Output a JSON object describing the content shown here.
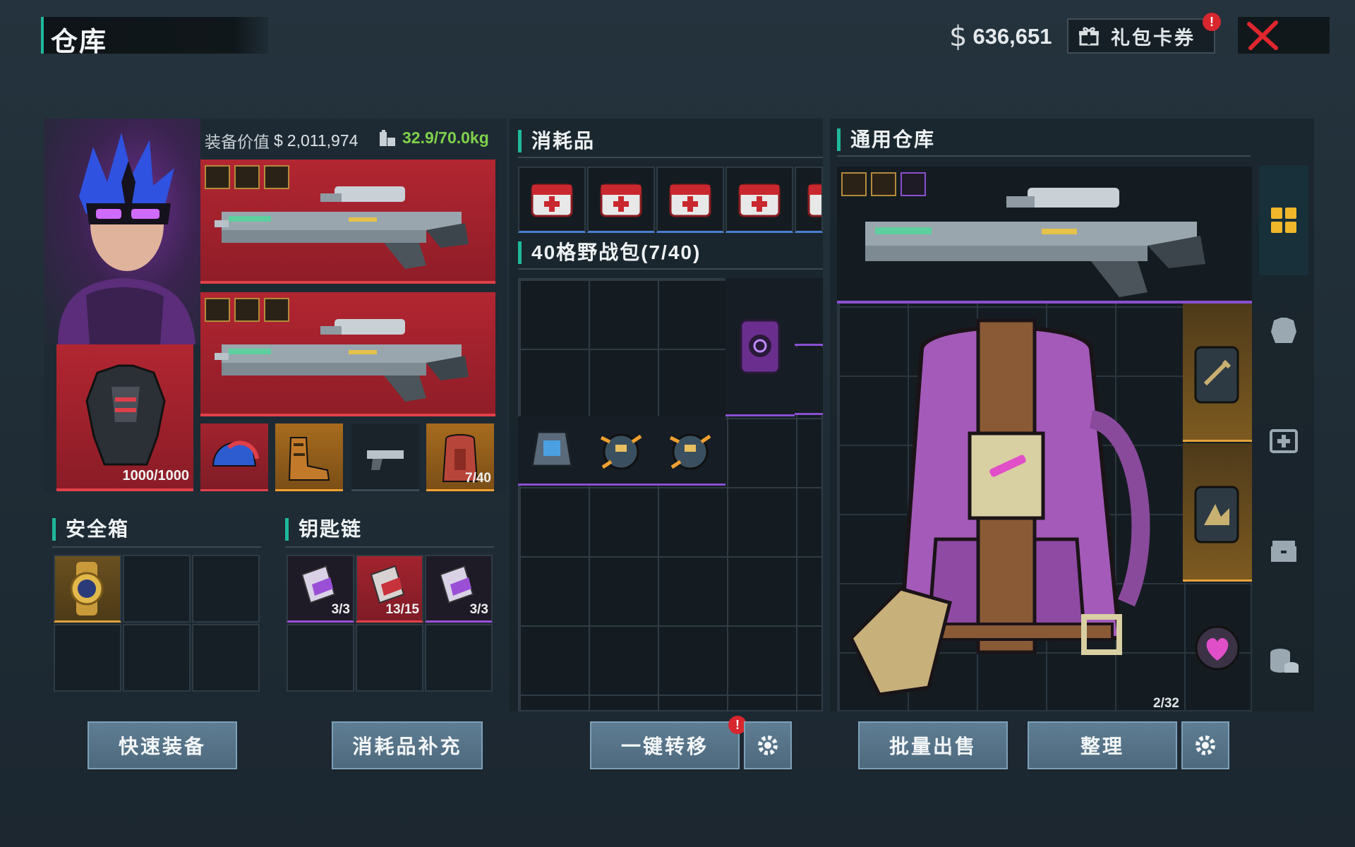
{
  "header": {
    "title": "仓库",
    "money": "636,651",
    "money_symbol": "$",
    "gift_label": "礼包卡券",
    "gift_badge": "!",
    "close_icon": "close-x-icon"
  },
  "equipment": {
    "value_label": "装备价值",
    "value_symbol": "$",
    "value": "2,011,974",
    "weight": "32.9/70.0kg",
    "armor_durability": "1000/1000",
    "backpack_count": "7/40",
    "weapons": [
      {
        "slot": "primary-1",
        "rarity": "red"
      },
      {
        "slot": "primary-2",
        "rarity": "red"
      }
    ],
    "small_slots": [
      {
        "name": "helmet",
        "rarity": "red"
      },
      {
        "name": "boots",
        "rarity": "orange"
      },
      {
        "name": "pistol",
        "rarity": "dark"
      },
      {
        "name": "backpack",
        "rarity": "orange"
      }
    ]
  },
  "safe_box": {
    "title": "安全箱",
    "items": [
      {
        "name": "gold-watch",
        "rarity": "gold"
      }
    ]
  },
  "keychain": {
    "title": "钥匙链",
    "items": [
      {
        "name": "key-card-purple-03",
        "count": "3/3"
      },
      {
        "name": "key-card-red-08",
        "count": "13/15"
      },
      {
        "name": "key-card-purple-04",
        "count": "3/3"
      }
    ]
  },
  "consumables": {
    "title": "消耗品",
    "items": [
      "medkit",
      "medkit",
      "medkit",
      "medkit",
      "medkit"
    ]
  },
  "field_pack": {
    "title": "40格野战包(7/40)"
  },
  "general_storage": {
    "title": "通用仓库",
    "count": "2/32"
  },
  "buttons": {
    "quick_equip": "快速装备",
    "restock": "消耗品补充",
    "transfer": "一键转移",
    "transfer_badge": "!",
    "bulk_sell": "批量出售",
    "organize": "整理"
  },
  "side_tabs": [
    "grid-icon",
    "armor-icon",
    "medkit-icon",
    "chest-icon",
    "coins-icon"
  ],
  "colors": {
    "accent": "#1fb89b",
    "rarity_red": "#b22631",
    "rarity_orange": "#a76b1e",
    "rarity_purple": "#8a4fd0",
    "weight_ok": "#7fd14b"
  }
}
